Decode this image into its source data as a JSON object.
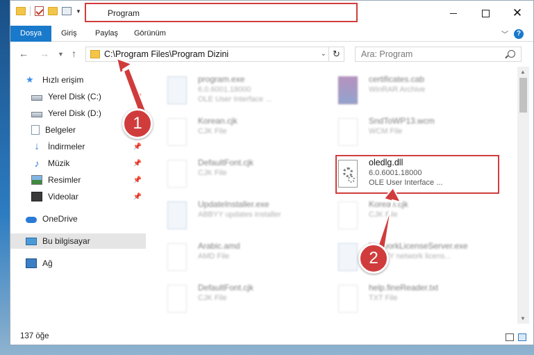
{
  "window": {
    "title": "Program"
  },
  "ribbon": {
    "tabs": [
      "Dosya",
      "Giriş",
      "Paylaş",
      "Görünüm"
    ],
    "help_symbol": "?"
  },
  "nav": {
    "address": "C:\\Program Files\\Program Dizini",
    "search_placeholder": "Ara: Program"
  },
  "sidebar": {
    "items": [
      {
        "label": "Hızlı erişim",
        "icon": "star-icon"
      },
      {
        "label": "Yerel Disk (C:)",
        "icon": "drive-icon",
        "pinned": true
      },
      {
        "label": "Yerel Disk (D:)",
        "icon": "drive-icon"
      },
      {
        "label": "Belgeler",
        "icon": "documents-icon"
      },
      {
        "label": "İndirmeler",
        "icon": "download-icon",
        "pinned": true
      },
      {
        "label": "Müzik",
        "icon": "music-icon",
        "pinned": true
      },
      {
        "label": "Resimler",
        "icon": "pictures-icon",
        "pinned": true
      },
      {
        "label": "Videolar",
        "icon": "videos-icon",
        "pinned": true
      },
      {
        "label": "OneDrive",
        "icon": "onedrive-icon"
      },
      {
        "label": "Bu bilgisayar",
        "icon": "computer-icon",
        "selected": true
      },
      {
        "label": "Ağ",
        "icon": "network-icon"
      }
    ]
  },
  "files": [
    {
      "name": "program.exe",
      "line2": "6.0.6001.18000",
      "line3": "OLE User Interface ...",
      "blurred": true
    },
    {
      "name": "certificates.cab",
      "line2": "WinRAR Archive",
      "line3": "",
      "blurred": true
    },
    {
      "name": "Korean.cjk",
      "line2": "CJK File",
      "line3": "",
      "blurred": true
    },
    {
      "name": "SndToWP13.wcm",
      "line2": "WCM File",
      "line3": "",
      "blurred": true
    },
    {
      "name": "DefaultFont.cjk",
      "line2": "CJK File",
      "line3": "",
      "blurred": true
    },
    {
      "name": "oledlg.dll",
      "line2": "6.0.6001.18000",
      "line3": "OLE User Interface ...",
      "blurred": false
    },
    {
      "name": "UpdateInstaller.exe",
      "line2": "ABBYY updates installer",
      "line3": "",
      "blurred": true
    },
    {
      "name": "Korean.cjk",
      "line2": "CJK File",
      "line3": "",
      "blurred": true
    },
    {
      "name": "Arabic.amd",
      "line2": "AMD File",
      "line3": "",
      "blurred": true
    },
    {
      "name": "NetworkLicenseServer.exe",
      "line2": "ABBYY network licens...",
      "line3": "",
      "blurred": true
    },
    {
      "name": "DefaultFont.cjk",
      "line2": "CJK File",
      "line3": "",
      "blurred": true
    },
    {
      "name": "help.fineReader.txt",
      "line2": "TXT File",
      "line3": "",
      "blurred": true
    }
  ],
  "status": {
    "item_count": "137 öğe"
  },
  "callouts": [
    "1",
    "2"
  ],
  "colors": {
    "accent": "#1979ca",
    "highlight": "#d03c3c"
  }
}
